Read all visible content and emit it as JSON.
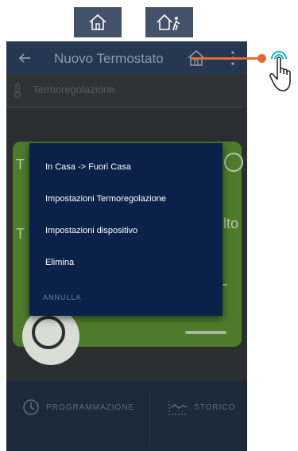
{
  "app_bar": {
    "title": "Nuovo Termostato"
  },
  "subheader": {
    "label": "Termoregolazione"
  },
  "card_fragments": {
    "t1": "T",
    "t2": "T",
    "suffix": "lto"
  },
  "menu": {
    "items": [
      {
        "label": "In Casa -> Fuori Casa"
      },
      {
        "label": "Impostazioni Termoregolazione"
      },
      {
        "label": "Impostazioni dispositivo"
      },
      {
        "label": "Elimina"
      }
    ],
    "cancel_label": "ANNULLA"
  },
  "bottom_nav": {
    "programming_label": "PROGRAMMAZIONE",
    "history_label": "STORICO"
  },
  "colors": {
    "app_bar": "#263752",
    "menu_background": "#0c2149",
    "card_green": "#4f7c2c",
    "pointer_accent": "#e8692d",
    "touch_icon_accent": "#1fb6c1"
  },
  "icons": [
    "home-icon",
    "home-away-icon",
    "back-arrow-icon",
    "more-vert-icon",
    "thermometer-icon",
    "clock-icon",
    "history-chart-icon",
    "touch-hand-icon"
  ]
}
